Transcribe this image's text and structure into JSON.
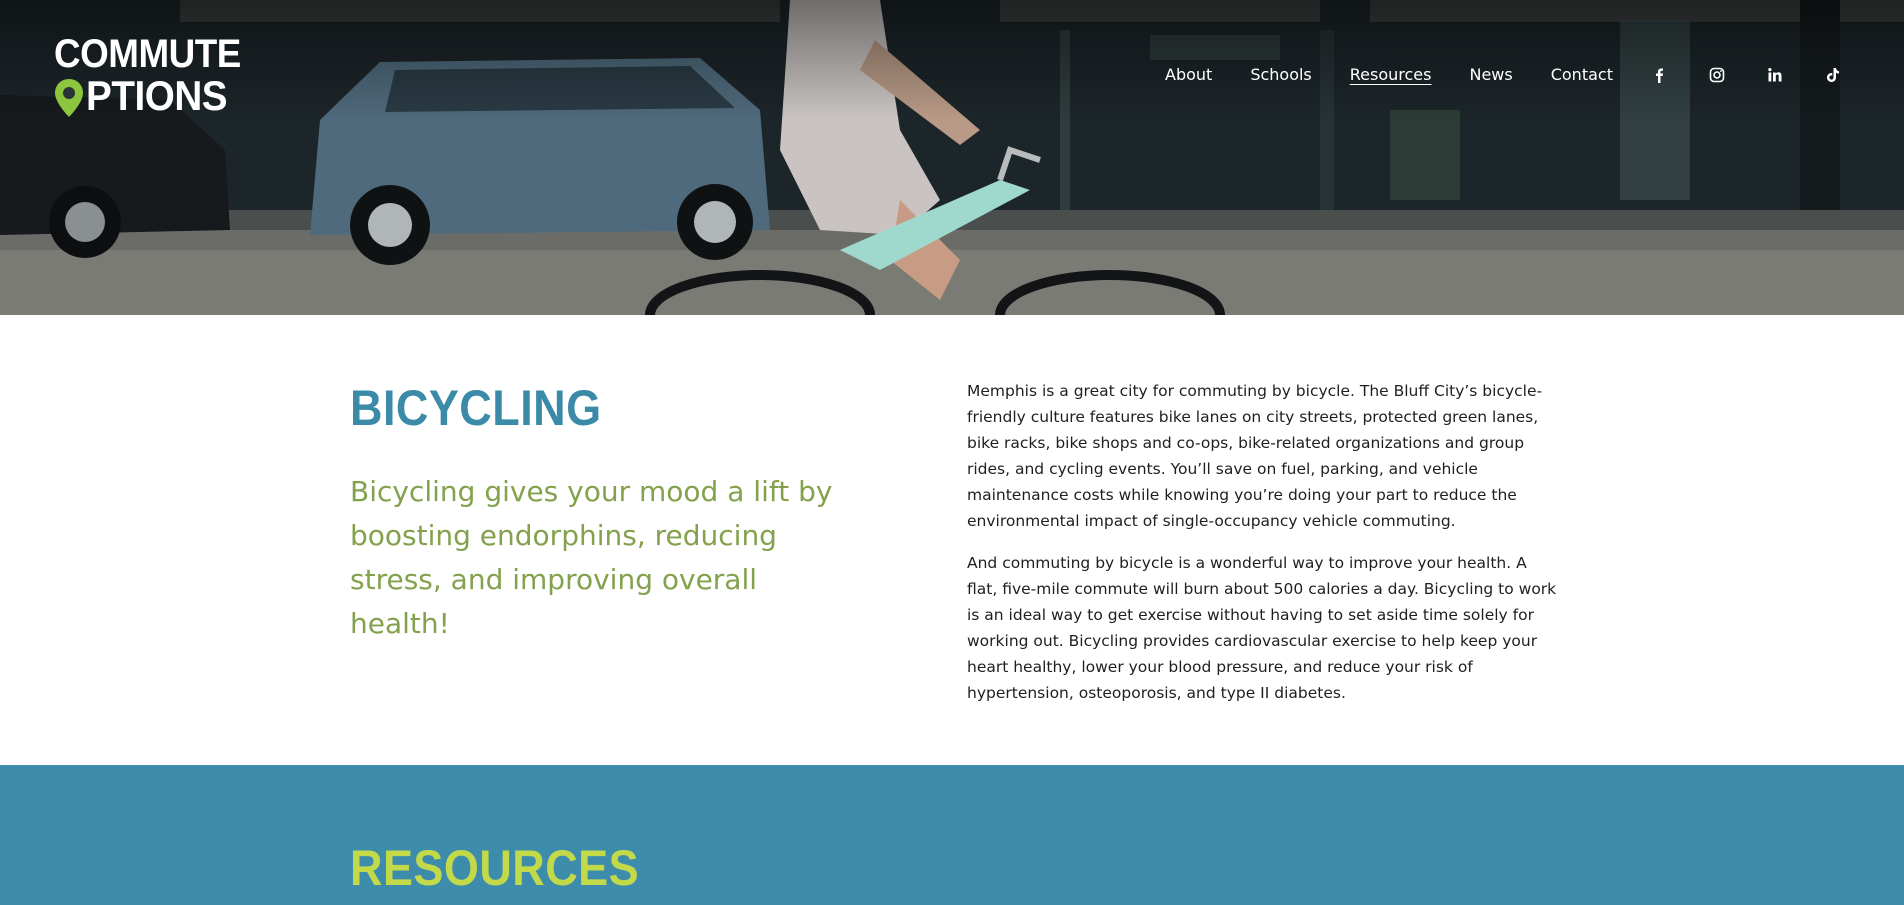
{
  "brand": {
    "logo_line1": "COMMUTE",
    "logo_line2": "PTIONS"
  },
  "nav": {
    "items": [
      {
        "label": "About"
      },
      {
        "label": "Schools"
      },
      {
        "label": "Resources",
        "active": true
      },
      {
        "label": "News"
      },
      {
        "label": "Contact"
      }
    ]
  },
  "social": {
    "icons": [
      "facebook-icon",
      "instagram-icon",
      "linkedin-icon",
      "tiktok-icon"
    ]
  },
  "intro": {
    "title": "BICYCLING",
    "tagline": "Bicycling gives your mood a lift by boosting endorphins, reducing stress, and improving overall health!",
    "paragraphs": [
      "Memphis is a great city for commuting by bicycle. The Bluff City’s bicycle-friendly culture features bike lanes on city streets, protected green lanes, bike racks, bike shops and co-ops, bike-related organizations and group rides, and cycling events. You’ll save on fuel, parking, and vehicle maintenance costs while knowing you’re doing your part to reduce the environmental impact of single-occupancy vehicle commuting.",
      "And commuting by bicycle is a wonderful way to improve your health. A flat, five-mile commute will burn about 500 calories a day. Bicycling to work is an ideal way to get exercise without having to set aside time solely for working out. Bicycling provides cardiovascular exercise to help keep your heart healthy, lower your blood pressure, and reduce your risk of hypertension, osteoporosis, and type II diabetes."
    ]
  },
  "resources": {
    "heading": "RESOURCES"
  },
  "colors": {
    "title_blue": "#3a8aa8",
    "tagline_green": "#84a24e",
    "band_blue": "#3d8cab",
    "band_heading": "#c2d94a",
    "logo_pin": "#8cc63f"
  }
}
